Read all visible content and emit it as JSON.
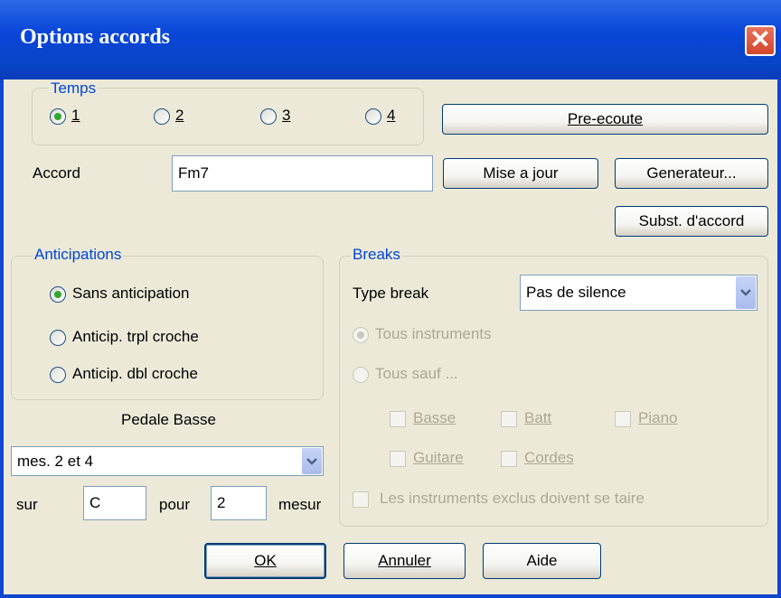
{
  "window": {
    "title": "Options accords"
  },
  "temps": {
    "legend": "Temps",
    "options": [
      "1",
      "2",
      "3",
      "4"
    ],
    "selected": "1"
  },
  "buttons": {
    "preecoute": "Pre-ecoute",
    "mise_a_jour": "Mise a jour",
    "generateur": "Generateur...",
    "subst": "Subst. d'accord",
    "ok": "OK",
    "annuler": "Annuler",
    "aide": "Aide"
  },
  "accord": {
    "label": "Accord",
    "value": "Fm7"
  },
  "anticipations": {
    "legend": "Anticipations",
    "options": [
      "Sans anticipation",
      "Anticip. trpl croche",
      "Anticip. dbl croche"
    ],
    "selected": "Sans anticipation"
  },
  "pedale": {
    "label": "Pedale Basse",
    "select_value": "mes. 2 et 4",
    "sur_label": "sur",
    "sur_value": "C",
    "pour_label": "pour",
    "pour_value": "2",
    "mesure_label": "mesur"
  },
  "breaks": {
    "legend": "Breaks",
    "type_label": "Type break",
    "type_value": "Pas de silence",
    "radio_all": "Tous instruments",
    "radio_except": "Tous sauf ...",
    "instruments": [
      "Basse",
      "Batt",
      "Piano",
      "Guitare",
      "Cordes"
    ],
    "silent_label": "Les instruments exclus doivent se taire"
  }
}
